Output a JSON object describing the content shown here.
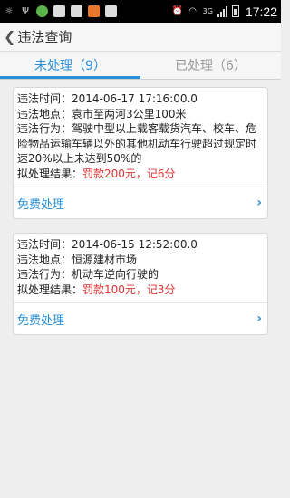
{
  "status_bar": {
    "time": "17:22",
    "network": "3G",
    "left_icons": [
      "brightness-icon",
      "usb-icon",
      "wechat-icon",
      "image-icon",
      "image-icon",
      "app-icon",
      "clipboard-icon"
    ],
    "right_icons": [
      "alarm-icon",
      "wifi-icon",
      "signal-icon",
      "battery-icon"
    ]
  },
  "header": {
    "back_icon": "chevron-left-icon",
    "title": "违法查询"
  },
  "tabs": [
    {
      "label": "未处理（9）",
      "active": true
    },
    {
      "label": "已处理（6）",
      "active": false
    }
  ],
  "colors": {
    "accent": "#2a8fd8",
    "penalty": "#e23131"
  },
  "records": [
    {
      "time_label": "违法时间：",
      "time_value": "2014-06-17 17:16:00.0",
      "place_label": "违法地点：",
      "place_value": "袁市至两河3公里100米",
      "behavior_label": "违法行为：",
      "behavior_value": "驾驶中型以上载客载货汽车、校车、危险物品运输车辆以外的其他机动车行驶超过规定时速20%以上未达到50%的",
      "result_label": "拟处理结果：",
      "result_value": "罚款200元，记6分",
      "action_label": "免费处理"
    },
    {
      "time_label": "违法时间：",
      "time_value": "2014-06-15 12:52:00.0",
      "place_label": "违法地点：",
      "place_value": "恒源建材市场",
      "behavior_label": "违法行为：",
      "behavior_value": "机动车逆向行驶的",
      "result_label": "拟处理结果：",
      "result_value": "罚款100元，记3分",
      "action_label": "免费处理"
    }
  ]
}
